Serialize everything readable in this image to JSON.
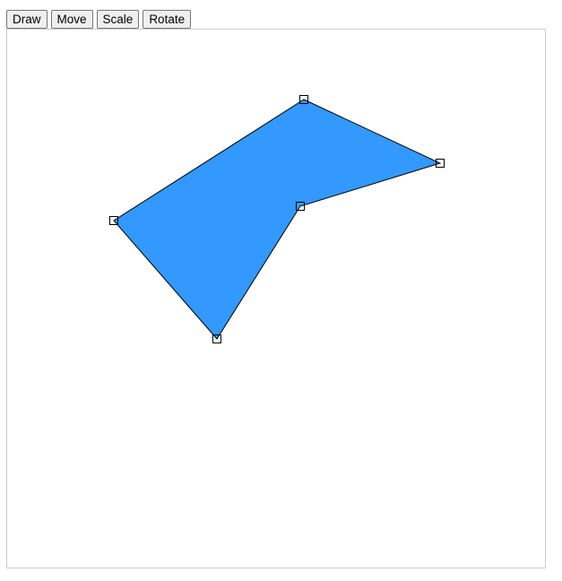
{
  "toolbar": {
    "draw_label": "Draw",
    "move_label": "Move",
    "scale_label": "Scale",
    "rotate_label": "Rotate"
  },
  "shape": {
    "fill_color": "#3399ff",
    "stroke_color": "#000000",
    "handle_fill": "#ffffff",
    "handle_stroke": "#000000"
  }
}
